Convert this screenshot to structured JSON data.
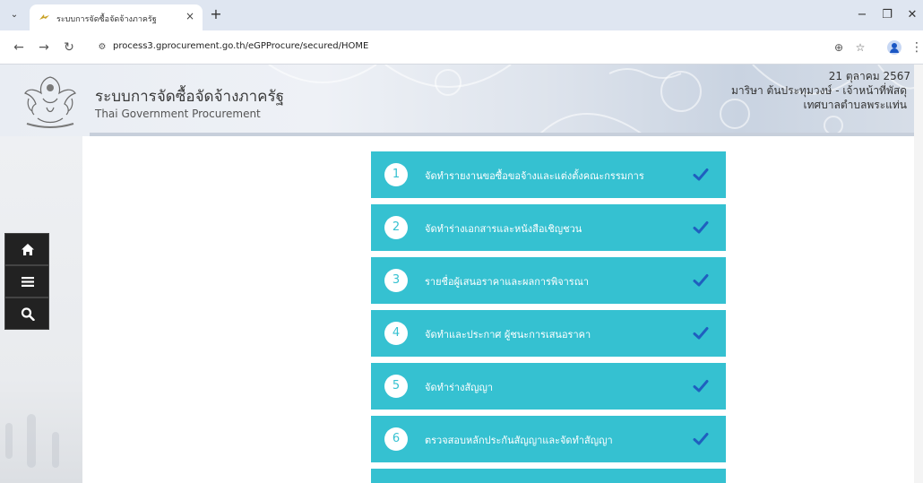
{
  "browser": {
    "tab_title": "ระบบการจัดซื้อจัดจ้างภาครัฐ",
    "tab_close": "×",
    "new_tab": "+",
    "tab_menu": "⌄",
    "url": "process3.gprocurement.go.th/eGPProcure/secured/HOME",
    "window_minimize": "−",
    "window_restore": "❐",
    "window_close": "✕"
  },
  "header": {
    "title": "ระบบการจัดซื้อจัดจ้างภาครัฐ",
    "subtitle": "Thai Government Procurement",
    "date": "21 ตุลาคม 2567",
    "user": "มาริษา ต้นประทุมวงษ์ - เจ้าหน้าที่พัสดุ",
    "organization": "เทศบาลตำบลพระแท่น"
  },
  "sidebar": {
    "items": [
      {
        "icon": "home-icon"
      },
      {
        "icon": "menu-icon"
      },
      {
        "icon": "search-icon"
      }
    ]
  },
  "steps": [
    {
      "number": "1",
      "label": "จัดทำรายงานขอซื้อขอจ้างและแต่งตั้งคณะกรรมการ",
      "completed": true
    },
    {
      "number": "2",
      "label": "จัดทำร่างเอกสารและหนังสือเชิญชวน",
      "completed": true
    },
    {
      "number": "3",
      "label": "รายชื่อผู้เสนอราคาและผลการพิจารณา",
      "completed": true
    },
    {
      "number": "4",
      "label": "จัดทำและประกาศ ผู้ชนะการเสนอราคา",
      "completed": true
    },
    {
      "number": "5",
      "label": "จัดทำร่างสัญญา",
      "completed": true
    },
    {
      "number": "6",
      "label": "ตรวจสอบหลักประกันสัญญาและจัดทำสัญญา",
      "completed": true
    }
  ],
  "colors": {
    "step_bg": "#35c1d1",
    "sidebar_button": "#222222",
    "check": "#1f5fbf"
  }
}
